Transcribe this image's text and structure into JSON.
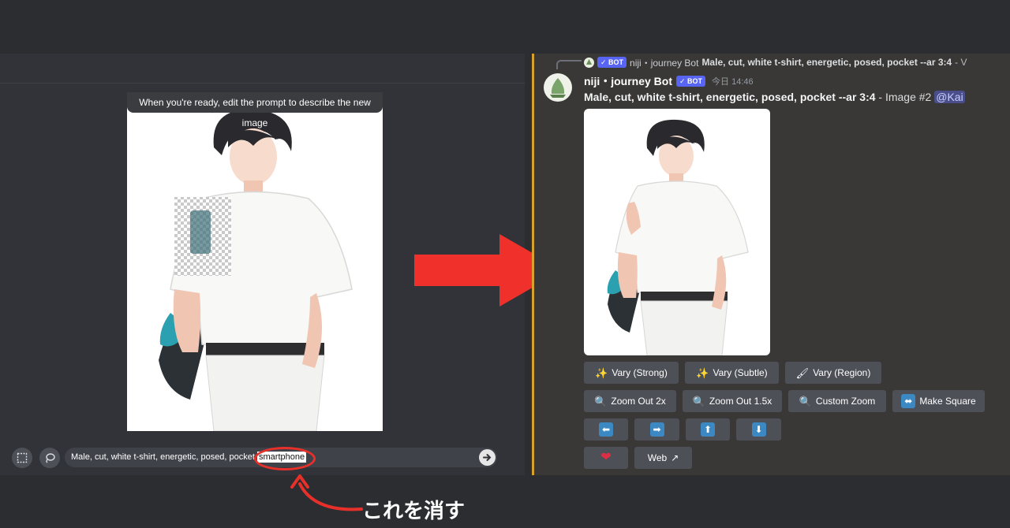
{
  "editor": {
    "tooltip": "When you're ready, edit the prompt to describe the new image",
    "prompt_before": "Male, cut, white t-shirt, energetic, posed, pocket",
    "prompt_highlight": "smartphone",
    "tools": [
      "select-tool",
      "lasso-tool"
    ]
  },
  "annotation": {
    "label": "これを消す",
    "color": "#e8302b"
  },
  "message": {
    "reply": {
      "name": "niji・journey Bot",
      "bot_tag": "✓ BOT",
      "prompt": "Male, cut, white t-shirt, energetic, posed, pocket --ar 3:4",
      "suffix": " - V"
    },
    "author": "niji・journey Bot",
    "bot_tag": "✓ BOT",
    "timestamp": "今日 14:46",
    "prompt": "Male, cut, white t-shirt, energetic, posed, pocket --ar 3:4",
    "image_label": " - Image #2 ",
    "mention": "@Kai",
    "accent_color": "#d7a12b"
  },
  "buttons": {
    "vary_strong": "Vary (Strong)",
    "vary_subtle": "Vary (Subtle)",
    "vary_region": "Vary (Region)",
    "zoom_out_2x": "Zoom Out 2x",
    "zoom_out_1_5x": "Zoom Out 1.5x",
    "custom_zoom": "Custom Zoom",
    "make_square": "Make Square",
    "web": "Web"
  },
  "icons": {
    "sparkle": "✨",
    "brush": "🖌",
    "magnifier": "🔍",
    "heart": "❤",
    "left": "⬅",
    "right": "➡",
    "up": "⬆",
    "down": "⬇",
    "swap": "⬌",
    "external": "↗"
  }
}
